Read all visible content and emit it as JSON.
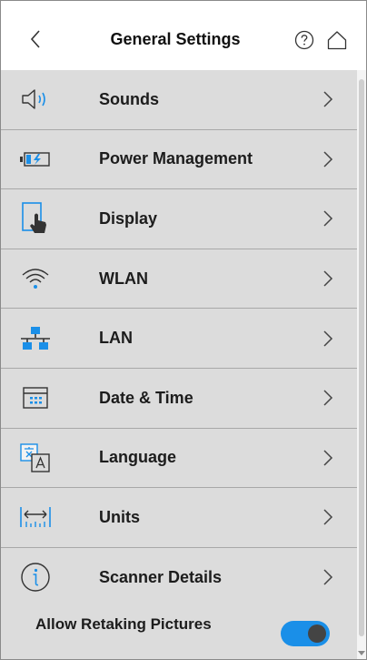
{
  "header": {
    "title": "General Settings",
    "back_icon": "chevron-left-icon",
    "help_icon": "help-circle-icon",
    "home_icon": "home-icon"
  },
  "settings": {
    "items": [
      {
        "label": "Sounds",
        "icon": "speaker-icon"
      },
      {
        "label": "Power Management",
        "icon": "battery-icon"
      },
      {
        "label": "Display",
        "icon": "touch-display-icon"
      },
      {
        "label": "WLAN",
        "icon": "wifi-icon"
      },
      {
        "label": "LAN",
        "icon": "network-icon"
      },
      {
        "label": "Date & Time",
        "icon": "calendar-icon"
      },
      {
        "label": "Language",
        "icon": "translate-icon"
      },
      {
        "label": "Units",
        "icon": "ruler-icon"
      },
      {
        "label": "Scanner Details",
        "icon": "info-icon"
      }
    ]
  },
  "retake": {
    "label": "Allow Retaking Pictures",
    "enabled": true
  },
  "colors": {
    "accent": "#1a8fe8",
    "row_bg": "#dcdcdc"
  }
}
